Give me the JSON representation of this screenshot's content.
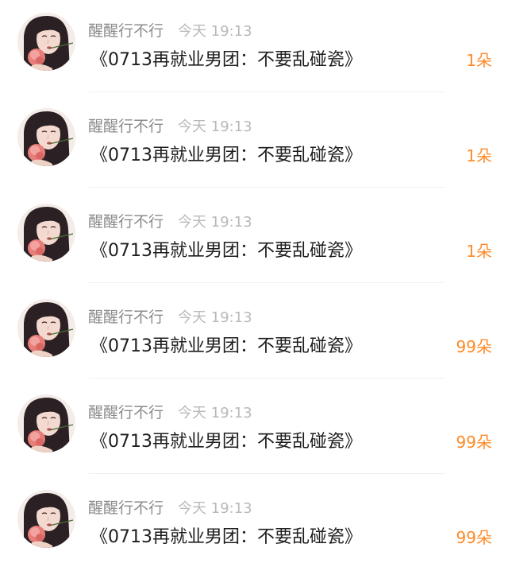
{
  "colors": {
    "accent": "#ff8a28",
    "username": "#8b8b8b",
    "time": "#b9b9b9",
    "title": "#1d1d1d",
    "divider": "#f0f0f0"
  },
  "items": [
    {
      "avatar_icon": "avatar-girl-with-rose-icon",
      "username": "醒醒行不行",
      "time": "今天 19:13",
      "title": "《0713再就业男团：不要乱碰瓷》",
      "count": "1朵"
    },
    {
      "avatar_icon": "avatar-girl-with-rose-icon",
      "username": "醒醒行不行",
      "time": "今天 19:13",
      "title": "《0713再就业男团：不要乱碰瓷》",
      "count": "1朵"
    },
    {
      "avatar_icon": "avatar-girl-with-rose-icon",
      "username": "醒醒行不行",
      "time": "今天 19:13",
      "title": "《0713再就业男团：不要乱碰瓷》",
      "count": "1朵"
    },
    {
      "avatar_icon": "avatar-girl-with-rose-icon",
      "username": "醒醒行不行",
      "time": "今天 19:13",
      "title": "《0713再就业男团：不要乱碰瓷》",
      "count": "99朵"
    },
    {
      "avatar_icon": "avatar-girl-with-rose-icon",
      "username": "醒醒行不行",
      "time": "今天 19:13",
      "title": "《0713再就业男团：不要乱碰瓷》",
      "count": "99朵"
    },
    {
      "avatar_icon": "avatar-girl-with-rose-icon",
      "username": "醒醒行不行",
      "time": "今天 19:13",
      "title": "《0713再就业男团：不要乱碰瓷》",
      "count": "99朵"
    }
  ]
}
